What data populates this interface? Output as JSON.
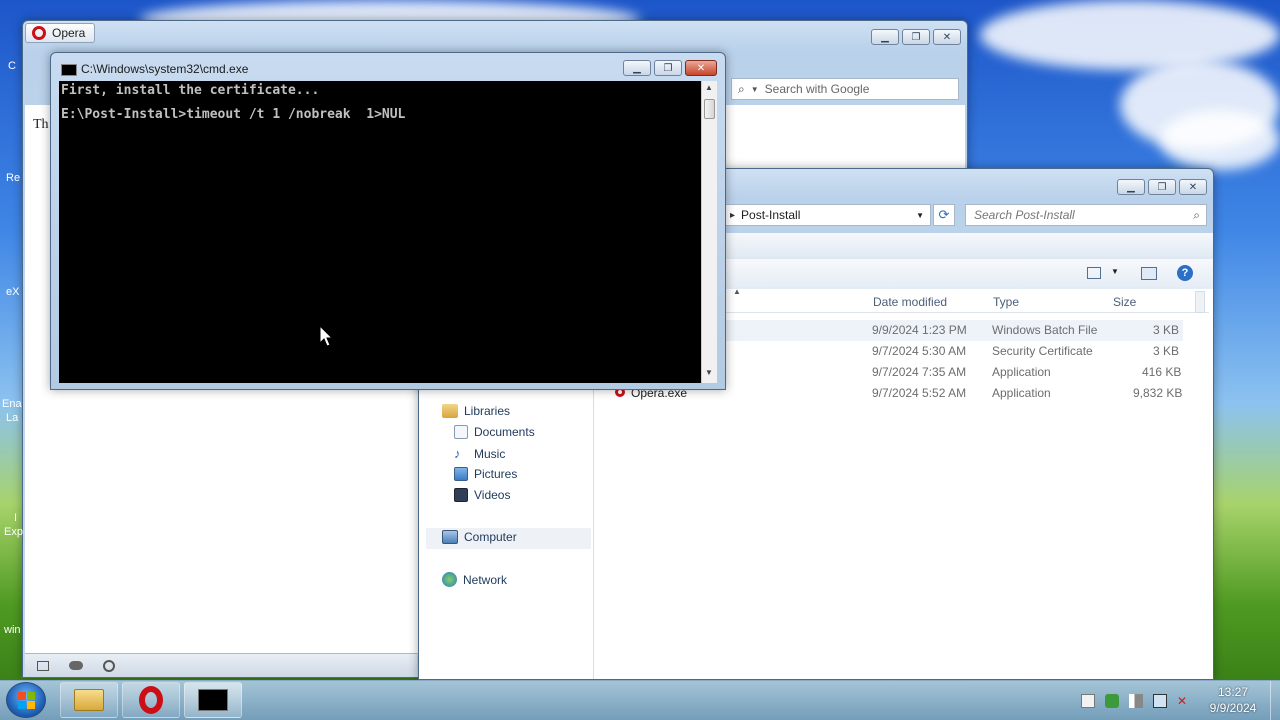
{
  "opera_window": {
    "tab_label": "Opera",
    "search_placeholder": "Search with Google",
    "page_text": "Th",
    "left_edge_texts": [
      "C",
      "Re",
      "eX",
      "Ena",
      "La",
      "I",
      "Exp",
      "win"
    ]
  },
  "cmd_window": {
    "title": "C:\\Windows\\system32\\cmd.exe",
    "lines": [
      "First, install the certificate...",
      "",
      "E:\\Post-Install>timeout /t 1 /nobreak  1>NUL"
    ]
  },
  "explorer_window": {
    "address_path": "Post-Install",
    "address_sep": "▸",
    "search_placeholder": "Search Post-Install",
    "columns": [
      "Date modified",
      "Type",
      "Size"
    ],
    "files": [
      {
        "name": "",
        "date": "9/9/2024 1:23 PM",
        "type": "Windows Batch File",
        "size": "3 KB"
      },
      {
        "name": "",
        "date": "9/7/2024 5:30 AM",
        "type": "Security Certificate",
        "size": "3 KB"
      },
      {
        "name": "",
        "date": "9/7/2024 7:35 AM",
        "type": "Application",
        "size": "416 KB"
      },
      {
        "name": "Opera.exe",
        "date": "9/7/2024 5:52 AM",
        "type": "Application",
        "size": "9,832 KB"
      }
    ],
    "nav": {
      "libraries": "Libraries",
      "documents": "Documents",
      "music": "Music",
      "pictures": "Pictures",
      "videos": "Videos",
      "computer": "Computer",
      "network": "Network"
    }
  },
  "taskbar": {
    "time": "13:27",
    "date": "9/9/2024"
  },
  "colors": {
    "cmd_bg": "#000000",
    "cmd_text": "#c0c0c0",
    "opera_red": "#cc0f16",
    "selection": "#e5eef8"
  }
}
